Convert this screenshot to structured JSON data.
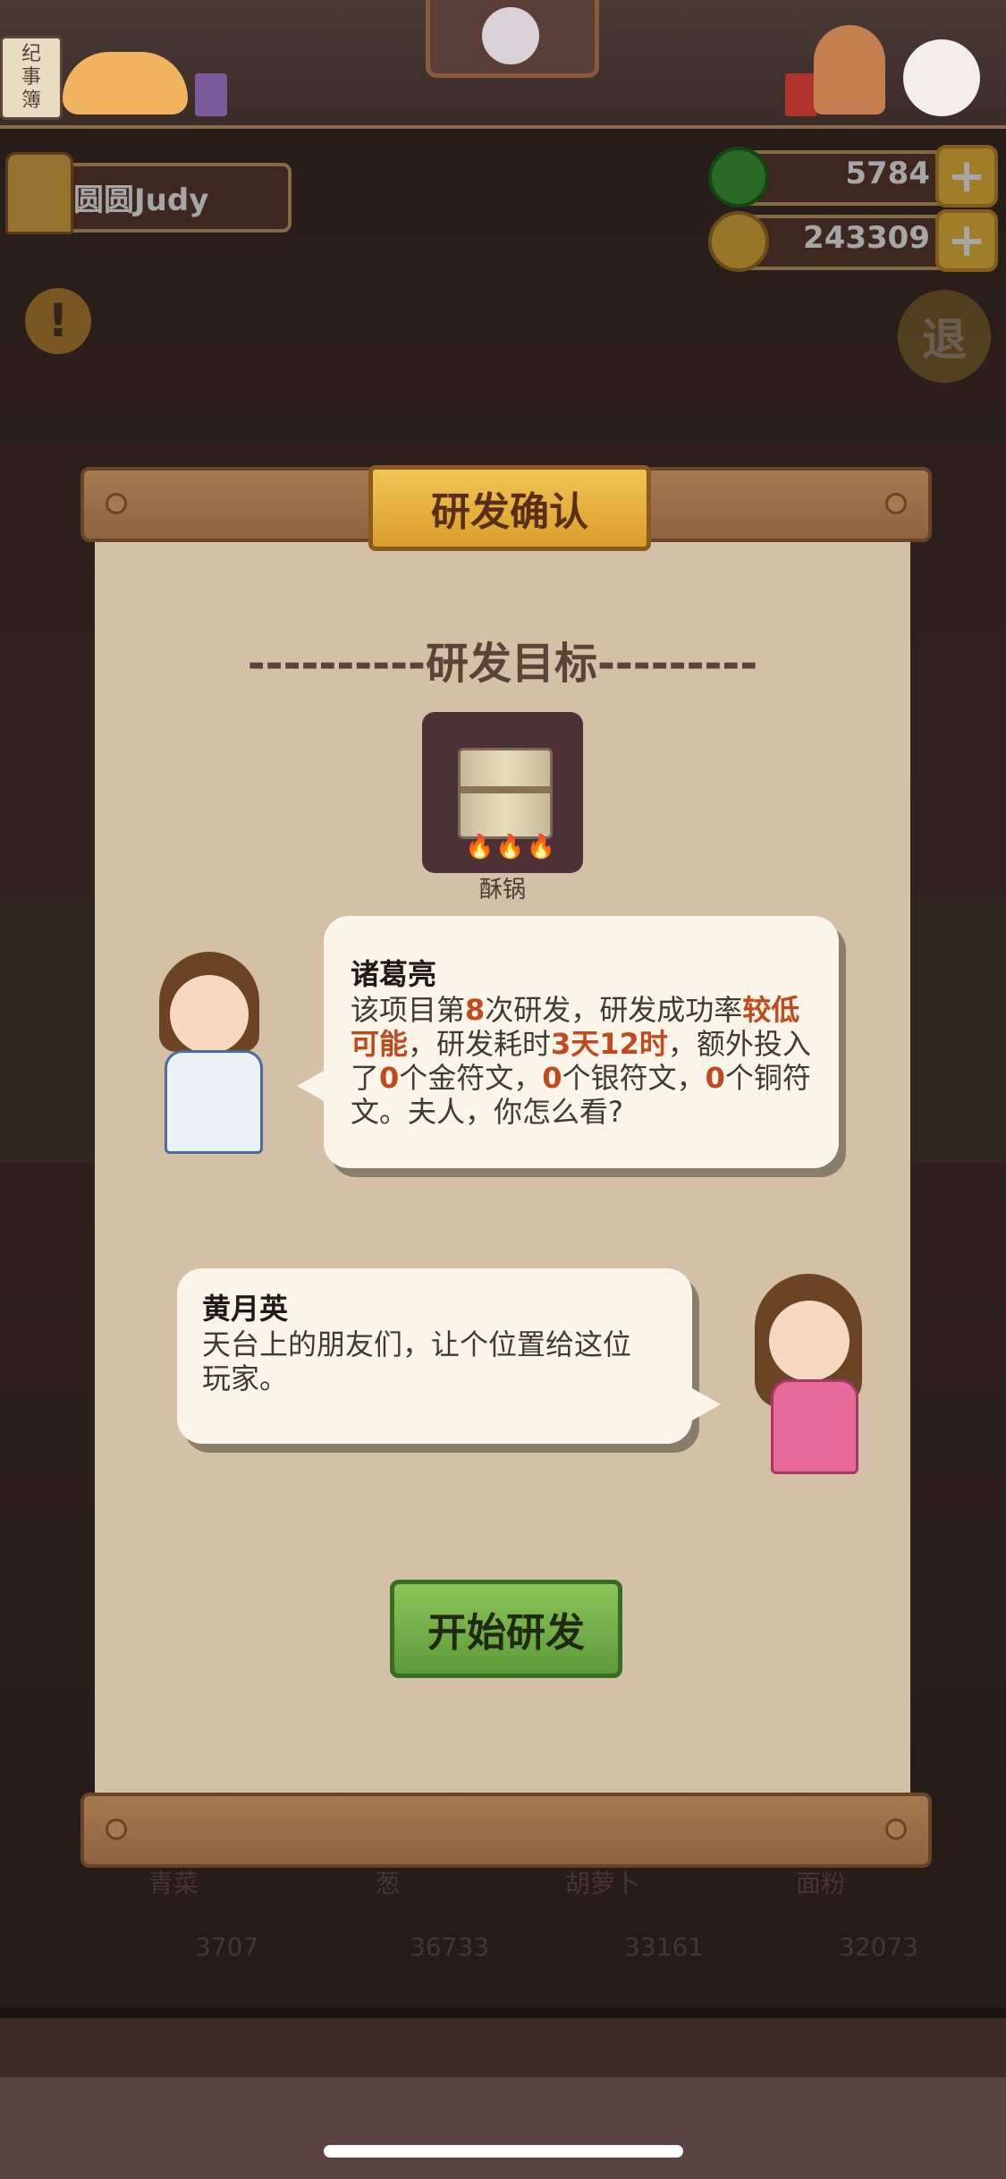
{
  "header": {
    "sign_text": "纪\n事\n簿",
    "player_name": "圆圆Judy"
  },
  "currencies": {
    "jade": {
      "value": "5784",
      "icon": "jade-coin-icon",
      "color": "#3fa13a"
    },
    "gold": {
      "value": "243309",
      "icon": "gold-coin-icon",
      "color": "#e9b640"
    }
  },
  "side_icons": {
    "warning": "!",
    "exit": "退"
  },
  "dialog": {
    "title": "研发确认",
    "section_title": "----------研发目标---------",
    "item": {
      "name": "酥锅",
      "flames": "🔥🔥🔥",
      "icon": "scroll-recipe-icon"
    },
    "speech1": {
      "speaker": "诸葛亮",
      "t1": "该项目第",
      "n_attempt": "8",
      "t2": "次研发，研发成功率",
      "rate": "较低可能",
      "t3": "，研发耗时",
      "duration": "3天12时",
      "t4": "，额外投入了",
      "gold_runes": "0",
      "t5": "个金符文，",
      "silver_runes": "0",
      "t6": "个银符文，",
      "copper_runes": "0",
      "t7": "个铜符文。夫人，你怎么看?"
    },
    "speech2": {
      "speaker": "黄月英",
      "text": "天台上的朋友们，让个位置给这位玩家。"
    },
    "start_button": "开始研发"
  },
  "background_items": [
    {
      "label": "青菜",
      "count": "3707"
    },
    {
      "label": "葱",
      "count": "36733"
    },
    {
      "label": "胡萝卜",
      "count": "33161"
    },
    {
      "label": "面粉",
      "count": "32073"
    }
  ],
  "colors": {
    "highlight": "#c2481d",
    "accent_gold": "#f2c456",
    "button_green": "#6fae45"
  }
}
